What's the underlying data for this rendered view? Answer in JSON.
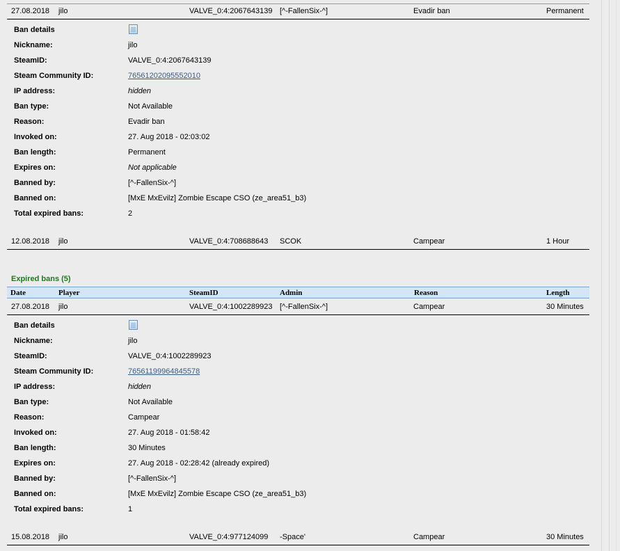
{
  "active_bans": {
    "rows": [
      {
        "date": "27.08.2018",
        "player": "jilo",
        "steamid": "VALVE_0:4:2067643139",
        "admin": "[^-FallenSix-^]",
        "reason": "Evadir ban",
        "length": "Permanent"
      },
      {
        "date": "12.08.2018",
        "player": "jilo",
        "steamid": "VALVE_0:4:708688643",
        "admin": "SCOK",
        "reason": "Campear",
        "length": "1 Hour"
      }
    ],
    "details": {
      "ban_details_label": "Ban details",
      "nickname_label": "Nickname:",
      "nickname": "jilo",
      "steamid_label": "SteamID:",
      "steamid": "VALVE_0:4:2067643139",
      "community_label": "Steam Community ID:",
      "community_id": "76561202095552010",
      "ip_label": "IP address:",
      "ip": "hidden",
      "bantype_label": "Ban type:",
      "bantype": "Not Available",
      "reason_label": "Reason:",
      "reason": "Evadir ban",
      "invoked_label": "Invoked on:",
      "invoked": "27. Aug 2018 - 02:03:02",
      "length_label": "Ban length:",
      "length": "Permanent",
      "expires_label": "Expires on:",
      "expires": "Not applicable",
      "bannedby_label": "Banned by:",
      "bannedby": "[^-FallenSix-^]",
      "bannedon_label": "Banned on:",
      "bannedon": "[MxE MxEvilz] Zombie Escape CSO (ze_area51_b3)",
      "total_label": "Total expired bans:",
      "total": "2"
    }
  },
  "expired_bans": {
    "title": "Expired bans (5)",
    "headers": {
      "date": "Date",
      "player": "Player",
      "steamid": "SteamID",
      "admin": "Admin",
      "reason": "Reason",
      "length": "Length"
    },
    "rows": [
      {
        "date": "27.08.2018",
        "player": "jilo",
        "steamid": "VALVE_0:4:1002289923",
        "admin": "[^-FallenSix-^]",
        "reason": "Campear",
        "length": "30 Minutes"
      },
      {
        "date": "15.08.2018",
        "player": "jilo",
        "steamid": "VALVE_0:4:977124099",
        "admin": "-Space'",
        "reason": "Campear",
        "length": "30 Minutes"
      }
    ],
    "details": {
      "ban_details_label": "Ban details",
      "nickname_label": "Nickname:",
      "nickname": "jilo",
      "steamid_label": "SteamID:",
      "steamid": "VALVE_0:4:1002289923",
      "community_label": "Steam Community ID:",
      "community_id": "76561199964845578",
      "ip_label": "IP address:",
      "ip": "hidden",
      "bantype_label": "Ban type:",
      "bantype": "Not Available",
      "reason_label": "Reason:",
      "reason": "Campear",
      "invoked_label": "Invoked on:",
      "invoked": "27. Aug 2018 - 01:58:42",
      "length_label": "Ban length:",
      "length": "30 Minutes",
      "expires_label": "Expires on:",
      "expires": "27. Aug 2018 - 02:28:42 (already expired)",
      "bannedby_label": "Banned by:",
      "bannedby": "[^-FallenSix-^]",
      "bannedon_label": "Banned on:",
      "bannedon": "[MxE MxEvilz] Zombie Escape CSO (ze_area51_b3)",
      "total_label": "Total expired bans:",
      "total": "1"
    }
  }
}
